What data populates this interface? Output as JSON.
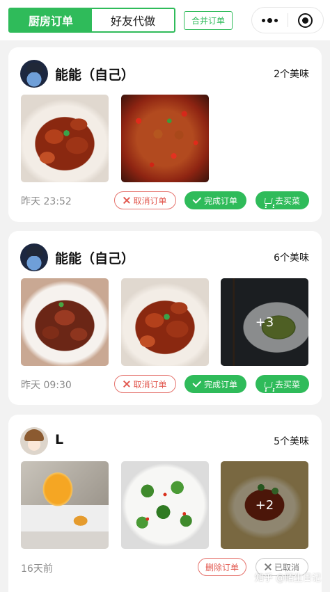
{
  "header": {
    "tabs": [
      {
        "label": "厨房订单",
        "active": true
      },
      {
        "label": "好友代做",
        "active": false
      }
    ],
    "merge_button": "合并订单",
    "capsule": {
      "menu_icon": "more-dots-icon",
      "close_icon": "target-close-icon"
    }
  },
  "orders": [
    {
      "user": "能能（自己）",
      "dish_count": "2个美味",
      "time": "昨天 23:52",
      "images": [
        "braised-pork-trotters",
        "spicy-chicken"
      ],
      "more": "",
      "actions": {
        "cancel": "取消订单",
        "complete": "完成订单",
        "buy": "去买菜"
      }
    },
    {
      "user": "能能（自己）",
      "dish_count": "6个美味",
      "time": "昨天 09:30",
      "images": [
        "braised-pork-plate",
        "braised-pork-trotters",
        "edamame-bowl"
      ],
      "more": "+3",
      "actions": {
        "cancel": "取消订单",
        "complete": "完成订单",
        "buy": "去买菜"
      }
    },
    {
      "user": "L",
      "dish_count": "5个美味",
      "time": "16天前",
      "images": [
        "citrus-tea",
        "broccoli-stir-fry",
        "braised-stew"
      ],
      "more": "+2",
      "actions": {
        "delete": "删除订单",
        "cancelled": "已取消"
      }
    }
  ],
  "watermark": "知乎 @陌生日记",
  "colors": {
    "accent": "#2fbb5a",
    "danger": "#e2584f",
    "muted": "#8a8a8a",
    "background": "#f2f2f2"
  }
}
